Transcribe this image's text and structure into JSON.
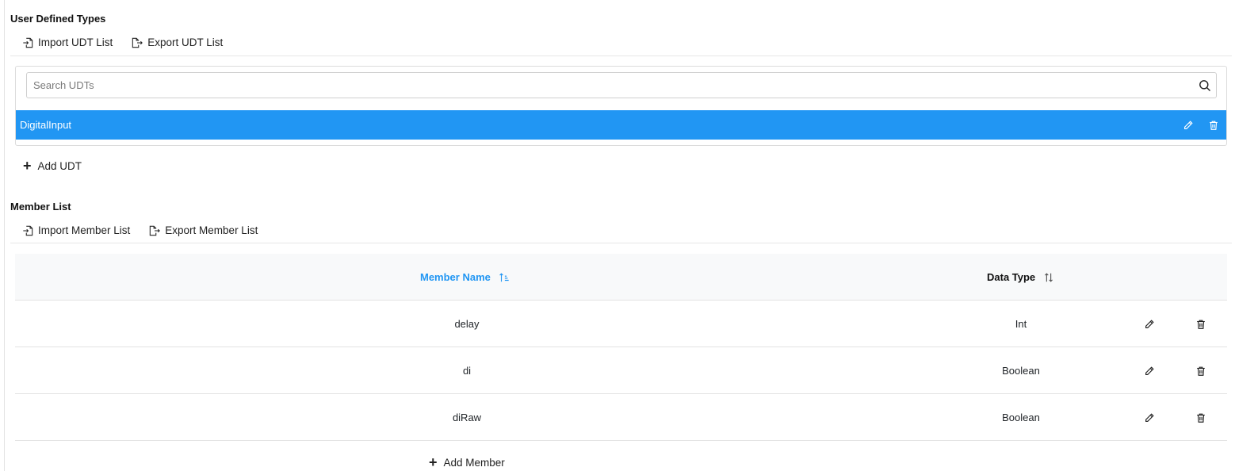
{
  "udt_section": {
    "title": "User Defined Types",
    "import_label": "Import UDT List",
    "export_label": "Export UDT List",
    "search_placeholder": "Search UDTs",
    "items": [
      {
        "name": "DigitalInput",
        "selected": true
      }
    ],
    "add_label": "Add UDT"
  },
  "member_section": {
    "title": "Member List",
    "import_label": "Import Member List",
    "export_label": "Export Member List",
    "columns": {
      "member_name": "Member Name",
      "data_type": "Data Type"
    },
    "rows": [
      {
        "member_name": "delay",
        "data_type": "Int"
      },
      {
        "member_name": "di",
        "data_type": "Boolean"
      },
      {
        "member_name": "diRaw",
        "data_type": "Boolean"
      }
    ],
    "add_label": "Add Member"
  },
  "colors": {
    "selected_row": "#2196f3",
    "sorted_header": "#2196f3",
    "header_bg": "#f8f9fa"
  },
  "icons": {
    "import": "import-icon",
    "export": "export-icon",
    "search": "search-icon",
    "edit": "pencil-icon",
    "delete": "trash-icon",
    "add": "plus-icon",
    "sort_asc": "sort-ascending-icon",
    "sort_none": "sort-icon"
  }
}
